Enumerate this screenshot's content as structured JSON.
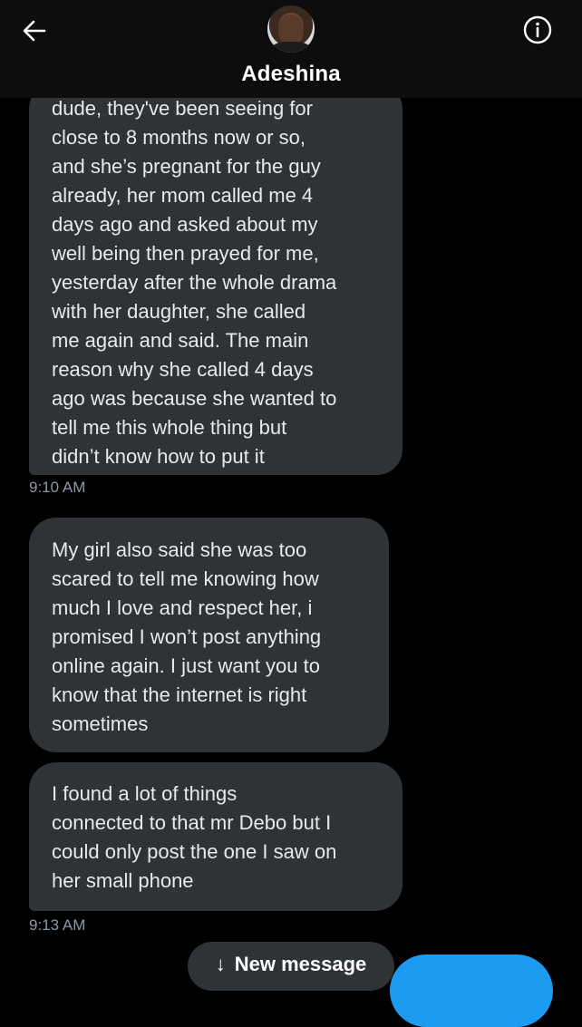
{
  "header": {
    "contact_name": "Adeshina",
    "back_icon": "arrow-left-icon",
    "info_icon": "info-circle-icon"
  },
  "messages": [
    {
      "text": "dude, they've been seeing for\nclose to 8 months now or so,\nand she’s pregnant for the guy\nalready, her mom called me 4\ndays ago and asked about my\nwell being then prayed for me,\nyesterday after the whole drama\nwith her daughter, she called\nme again and said. The main\nreason why she called 4 days\nago was because she wanted to\ntell me this whole thing but\ndidn’t know how to put it",
      "time": "9:10 AM"
    },
    {
      "text": "My girl also said she was too\nscared to tell me knowing how\nmuch I love and respect her, i\npromised I won’t post anything\nonline again. I just want you to\nknow that the internet is right\nsometimes"
    },
    {
      "text": "I found a lot of things\nconnected to that mr Debo but I\ncould only post the one I saw on\nher small phone",
      "time": "9:13 AM"
    }
  ],
  "new_message_pill": {
    "arrow": "↓",
    "label": "New message"
  },
  "colors": {
    "background": "#000000",
    "bubble": "#2f3336",
    "accent": "#1d9bf0",
    "timestamp": "#8b98a5"
  }
}
